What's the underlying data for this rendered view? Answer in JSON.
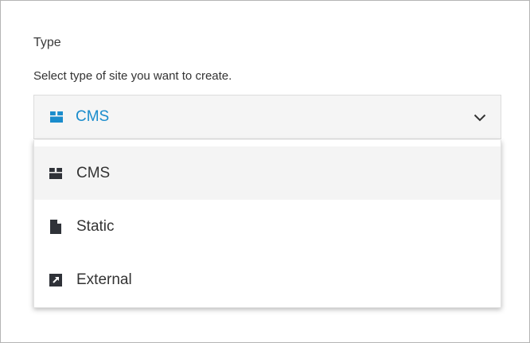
{
  "field": {
    "label": "Type",
    "description": "Select type of site you want to create."
  },
  "select": {
    "selected_label": "CMS",
    "selected_icon": "box-icon",
    "accent_color": "#1a8ccc"
  },
  "options": [
    {
      "label": "CMS",
      "icon": "box-icon",
      "highlighted": true
    },
    {
      "label": "Static",
      "icon": "file-icon",
      "highlighted": false
    },
    {
      "label": "External",
      "icon": "external-link-icon",
      "highlighted": false
    }
  ]
}
